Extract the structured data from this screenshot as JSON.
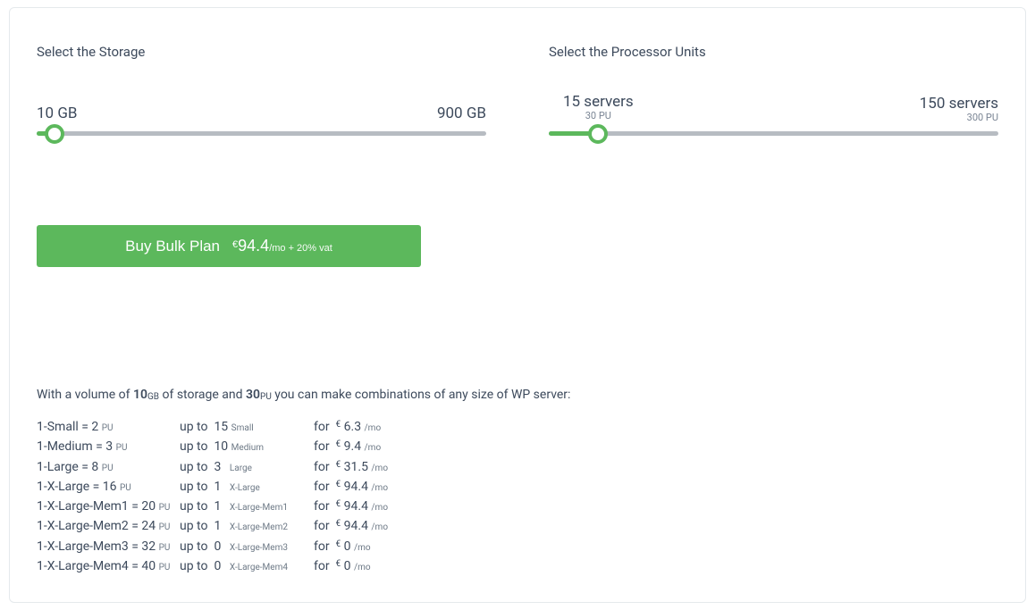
{
  "storage": {
    "label": "Select the Storage",
    "min_label": "10 GB",
    "max_label": "900 GB",
    "handle_percent": 4
  },
  "processor": {
    "label": "Select the Processor Units",
    "current_servers": "15 servers",
    "current_pu": "30 PU",
    "max_servers": "150 servers",
    "max_pu": "300 PU",
    "handle_percent": 11
  },
  "buy": {
    "title": "Buy Bulk Plan",
    "currency": "€",
    "amount": "94.4",
    "suffix": "/mo + 20% vat"
  },
  "summary": {
    "prefix": "With a volume of ",
    "storage_amount": "10",
    "storage_unit": "GB",
    "mid1": " of storage and ",
    "pu_amount": "30",
    "pu_unit": "PU",
    "suffix": " you can make combinations of any size of WP server:"
  },
  "combos": [
    {
      "name": "1-Small",
      "pu": "2",
      "upto": "15",
      "label": "Small",
      "price": "6.3"
    },
    {
      "name": "1-Medium",
      "pu": "3",
      "upto": "10",
      "label": "Medium",
      "price": "9.4"
    },
    {
      "name": "1-Large",
      "pu": "8",
      "upto": "3",
      "label": "Large",
      "price": "31.5"
    },
    {
      "name": "1-X-Large",
      "pu": "16",
      "upto": "1",
      "label": "X-Large",
      "price": "94.4"
    },
    {
      "name": "1-X-Large-Mem1",
      "pu": "20",
      "upto": "1",
      "label": "X-Large-Mem1",
      "price": "94.4"
    },
    {
      "name": "1-X-Large-Mem2",
      "pu": "24",
      "upto": "1",
      "label": "X-Large-Mem2",
      "price": "94.4"
    },
    {
      "name": "1-X-Large-Mem3",
      "pu": "32",
      "upto": "0",
      "label": "X-Large-Mem3",
      "price": "0"
    },
    {
      "name": "1-X-Large-Mem4",
      "pu": "40",
      "upto": "0",
      "label": "X-Large-Mem4",
      "price": "0"
    }
  ],
  "labels": {
    "pu_unit": "PU",
    "upto": "up to",
    "for": "for",
    "currency": "€",
    "per_mo": "/mo"
  }
}
